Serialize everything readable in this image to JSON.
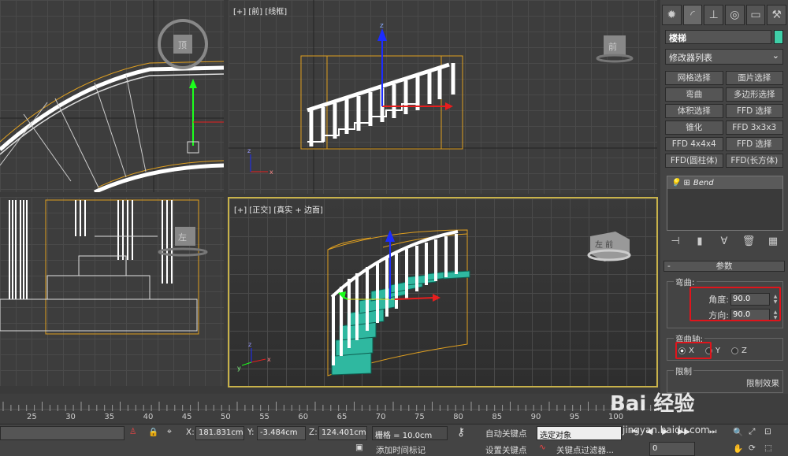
{
  "viewports": {
    "front_label": "[+] [前] [线框]",
    "front_cube": "前",
    "top_cube": "顶",
    "left_cube": "左",
    "persp_label": "[+] [正交] [真实 + 边面]",
    "persp_cube": "左 前",
    "axis_x": "x",
    "axis_y": "y",
    "axis_z": "z"
  },
  "panel": {
    "object_name": "楼梯",
    "modifier_list": "修改器列表",
    "modifiers": [
      "网格选择",
      "面片选择",
      "弯曲",
      "多边形选择",
      "体积选择",
      "FFD 选择",
      "锥化",
      "FFD 3x3x3",
      "FFD 4x4x4",
      "FFD 选择",
      "FFD(圆柱体)",
      "FFD(长方体)"
    ],
    "stack_item": "Bend",
    "rollout_title": "参数",
    "bend_group": "弯曲:",
    "angle_label": "角度:",
    "angle_value": "90.0",
    "direction_label": "方向:",
    "direction_value": "90.0",
    "axis_group": "弯曲轴:",
    "axis_x": "X",
    "axis_y": "Y",
    "axis_z": "Z",
    "limit_group": "限制",
    "limit_effect": "限制效果"
  },
  "timeline": {
    "ticks": [
      "25",
      "30",
      "35",
      "40",
      "45",
      "50",
      "55",
      "60",
      "65",
      "70",
      "75",
      "80",
      "85",
      "90",
      "95",
      "100"
    ]
  },
  "status": {
    "x_label": "X:",
    "x_value": "181.831cm",
    "y_label": "Y:",
    "y_value": "-3.484cm",
    "z_label": "Z:",
    "z_value": "124.401cm",
    "grid": "栅格 = 10.0cm",
    "auto_key": "自动关键点",
    "selected_object": "选定对象",
    "set_key": "设置关键点",
    "key_filter": "关键点过滤器...",
    "add_time_tag": "添加时间标记",
    "frame_value": "0"
  },
  "watermark": {
    "brand": "Bai 经验",
    "url": "jingyan.baidu.com"
  },
  "colors": {
    "highlight": "#e0141b",
    "active_viewport": "#c8b24a",
    "stairs_teal": "#2fb8a0",
    "bbox": "#e0a020"
  }
}
